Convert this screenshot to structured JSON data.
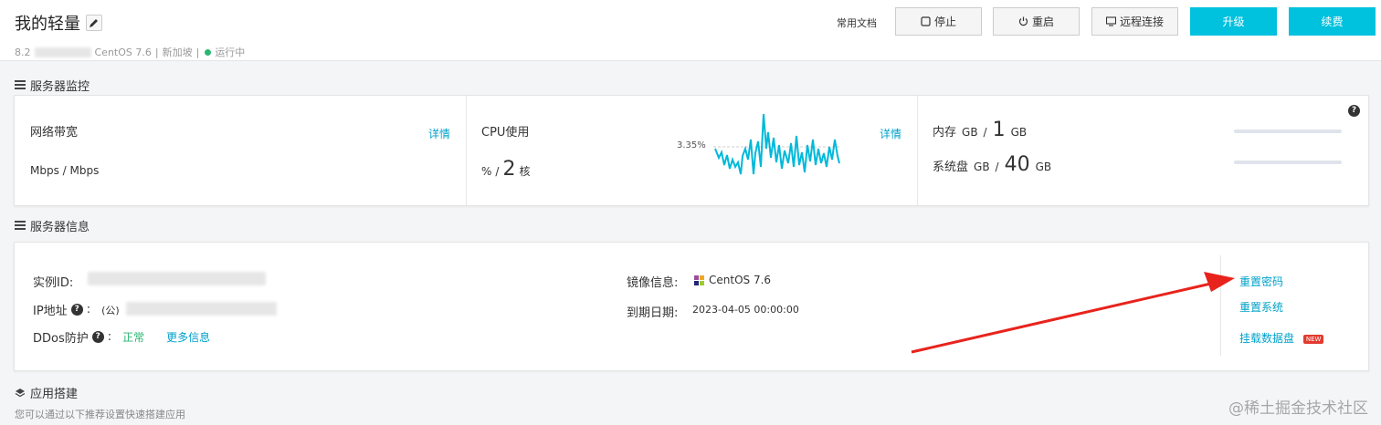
{
  "header": {
    "title": "我的轻量",
    "ip_prefix": "8.2",
    "os": "CentOS 7.6",
    "region": "新加坡",
    "status": "运行中",
    "doc_link": "常用文档",
    "buttons": {
      "stop": "停止",
      "restart": "重启",
      "remote": "远程连接",
      "upgrade": "升级",
      "renew": "续费"
    }
  },
  "monitor": {
    "section_title": "服务器监控",
    "bandwidth": {
      "label": "网络带宽",
      "detail": "详情",
      "value": "Mbps / Mbps"
    },
    "cpu": {
      "label": "CPU使用",
      "detail": "详情",
      "percent_unit": "%",
      "slash": "/",
      "cores": "2",
      "cores_unit": "核",
      "current": "3.35%"
    },
    "memory": {
      "label": "内存",
      "unit_used": "GB",
      "slash": "/",
      "total": "1",
      "unit_total": "GB"
    },
    "disk": {
      "label": "系统盘",
      "unit_used": "GB",
      "slash": "/",
      "total": "40",
      "unit_total": "GB"
    },
    "help": "?"
  },
  "info": {
    "section_title": "服务器信息",
    "instance_id_label": "实例ID:",
    "ip_label": "IP地址",
    "ip_colon": ":",
    "ip_public": "(公)",
    "ddos_label": "DDos防护",
    "ddos_colon": ":",
    "ddos_status": "正常",
    "more_info": "更多信息",
    "image_label": "镜像信息:",
    "image_value": "CentOS 7.6",
    "expire_label": "到期日期:",
    "expire_value": "2023-04-05 00:00:00",
    "actions": {
      "reset_password": "重置密码",
      "reset_system": "重置系统",
      "mount_disk": "挂载数据盘",
      "new_badge": "NEW"
    },
    "help": "?"
  },
  "apps": {
    "section_title": "应用搭建",
    "subtitle": "您可以通过以下推荐设置快速搭建应用"
  },
  "watermark": "@稀土掘金技术社区",
  "colors": {
    "accent": "#00c1de",
    "link": "#00a2ca",
    "success": "#2bb673",
    "annotation_arrow": "#e8231c"
  }
}
